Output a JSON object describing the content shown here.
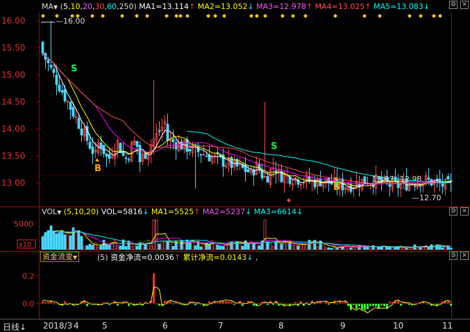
{
  "main_chart": {
    "indicator_name": "MA",
    "params": "(5,10,20,30,60,250)",
    "params_parts": [
      "5",
      "10",
      "20",
      "30",
      "60",
      "250"
    ],
    "ma1": "MA1=13.114",
    "ma2": "MA2=13.052",
    "ma3": "MA3=12.978",
    "ma4": "MA4=13.025",
    "ma5": "MA5=13.083",
    "y_ticks": [
      "16.00",
      "15.50",
      "15.00",
      "14.50",
      "14.00",
      "13.50",
      "13.00"
    ],
    "annotations": {
      "high": "16.00",
      "low": "12.70",
      "price_a": "12.97",
      "price_b": "12.98",
      "signal_s": "S",
      "signal_b": "B"
    }
  },
  "volume_chart": {
    "indicator_name": "VOL",
    "params": "(5,10,20)",
    "vol": "VOL=5816",
    "ma1": "MA1=5525",
    "ma2": "MA2=5237",
    "ma3": "MA3=6614",
    "y_tick": "5000",
    "unit": "x10"
  },
  "flow_chart": {
    "indicator_name": "资金流变",
    "param": "(5)",
    "net_flow": "资金净流=0.0036",
    "cum_flow": "累计净流=0.0143",
    "y_ticks": [
      "0.2",
      "0.0"
    ]
  },
  "bottom": {
    "period": "日线",
    "dates": [
      "2018/3",
      "4",
      "5",
      "6",
      "7",
      "8",
      "9",
      "10",
      "11"
    ]
  },
  "colors": {
    "up": "#ff4a4a",
    "down": "#4ad8ff",
    "ma1": "#ffffff",
    "ma2": "#ffff00",
    "ma3": "#ff00ff",
    "ma4": "#ff5050",
    "ma5": "#00ffff",
    "axis": "#c00000"
  }
}
